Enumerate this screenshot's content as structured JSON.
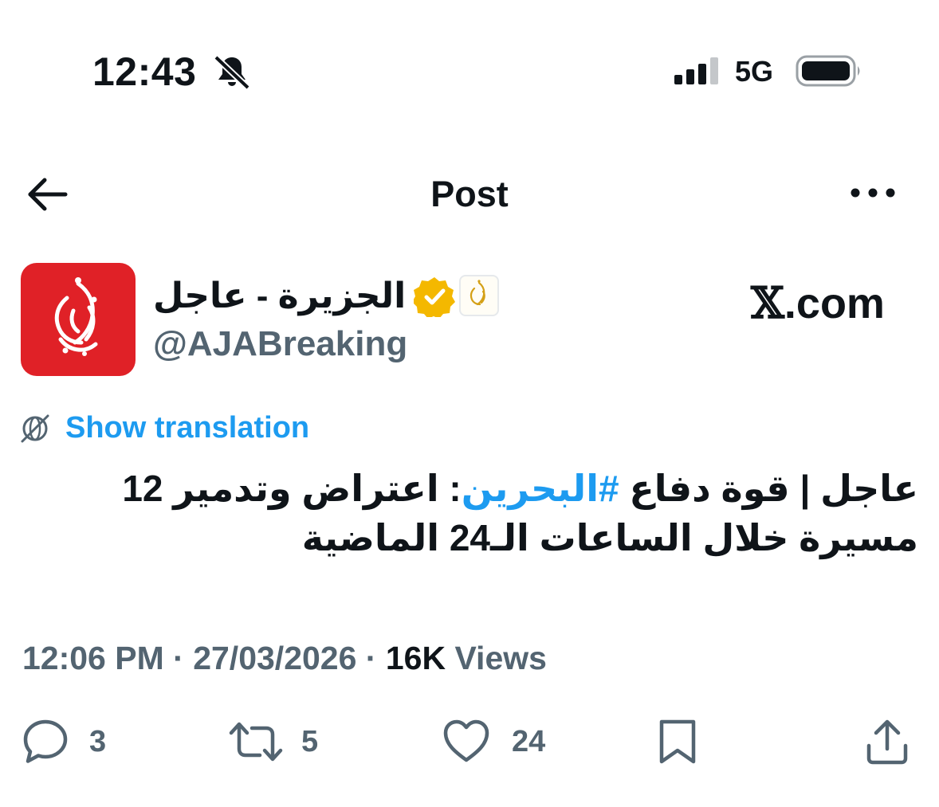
{
  "status_bar": {
    "time": "12:43",
    "network": "5G"
  },
  "nav": {
    "title": "Post"
  },
  "author": {
    "name": "الجزيرة - عاجل",
    "handle": "@AJABreaking",
    "verified_color": "#f4b800"
  },
  "source": {
    "domain_suffix": ".com",
    "x_glyph": "𝕏"
  },
  "translate": {
    "label": "Show translation"
  },
  "tweet": {
    "text_before": "عاجل | قوة دفاع ",
    "hashtag": "#البحرين",
    "text_after": ": اعتراض وتدمير 12 مسيرة خلال الساعات الـ24 الماضية"
  },
  "meta": {
    "time": "12:06 PM",
    "separator": " · ",
    "date": "27/03/2026",
    "views_count": "16K",
    "views_label": " Views"
  },
  "actions": {
    "replies": "3",
    "reposts": "5",
    "likes": "24"
  },
  "colors": {
    "accent": "#1d9bf0",
    "secondary_text": "#536471",
    "avatar_bg": "#e02127"
  }
}
